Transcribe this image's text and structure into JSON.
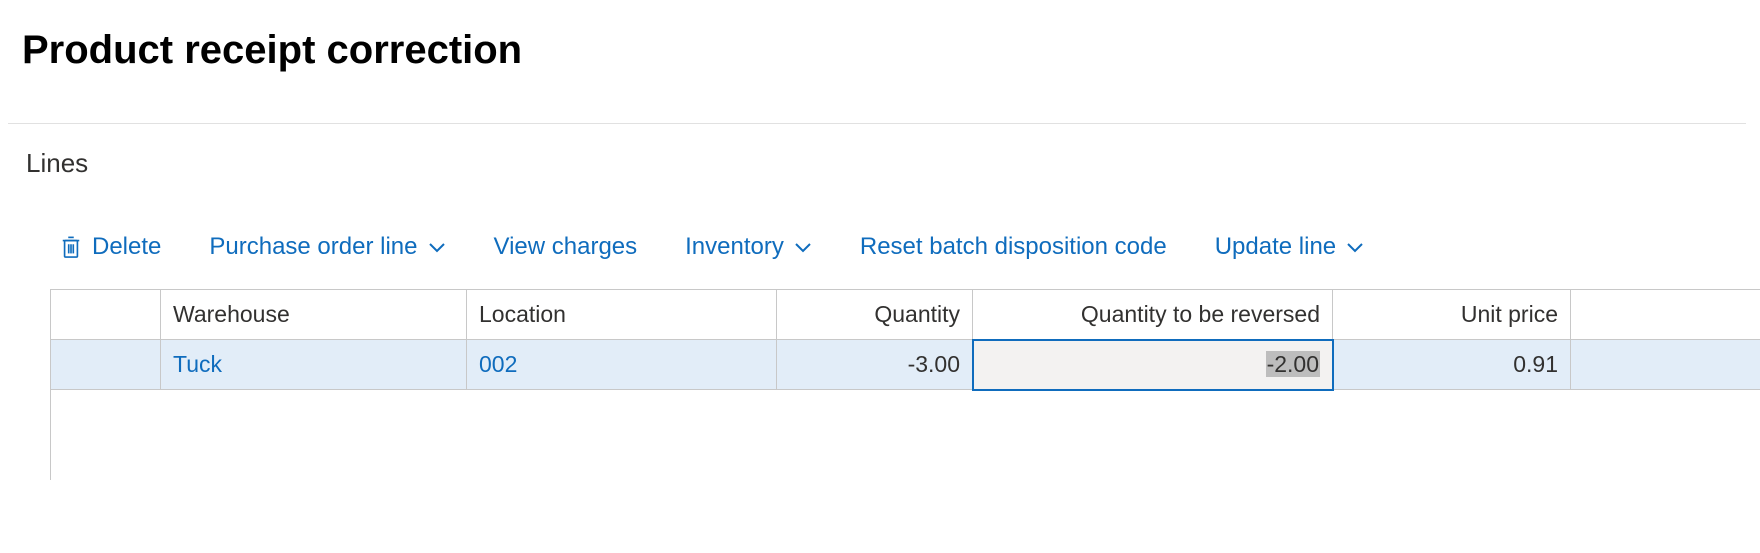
{
  "header": {
    "title": "Product receipt correction"
  },
  "section": {
    "title": "Lines"
  },
  "toolbar": {
    "delete": "Delete",
    "purchase_order_line": "Purchase order line",
    "view_charges": "View charges",
    "inventory": "Inventory",
    "reset_batch": "Reset batch disposition code",
    "update_line": "Update line"
  },
  "table": {
    "columns": {
      "warehouse": "Warehouse",
      "location": "Location",
      "quantity": "Quantity",
      "qty_reversed": "Quantity to be reversed",
      "unit_price": "Unit price"
    },
    "rows": [
      {
        "warehouse": "Tuck",
        "location": "002",
        "quantity": "-3.00",
        "qty_reversed": "-2.00",
        "unit_price": "0.91"
      }
    ]
  }
}
